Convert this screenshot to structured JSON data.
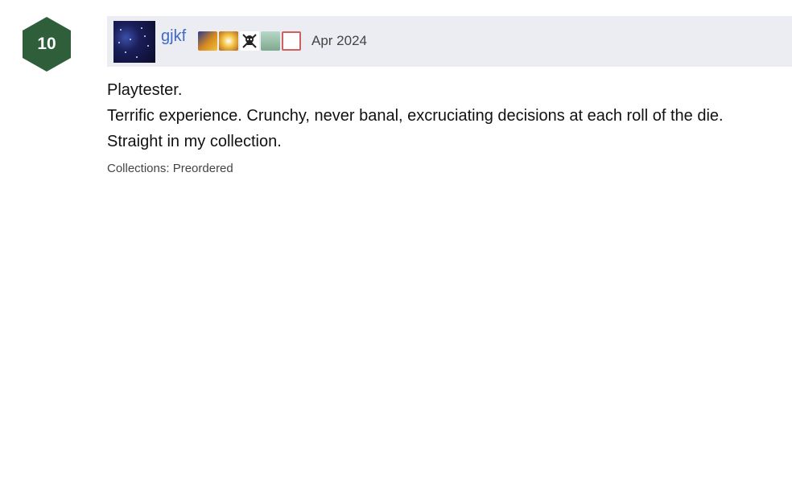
{
  "rating": {
    "value": "10",
    "color": "#2e5e3a"
  },
  "review": {
    "username": "gjkf",
    "date": "Apr 2024",
    "badges": [
      "award-badge",
      "sun-badge",
      "skull-badge",
      "figure-badge",
      "dice-badge"
    ],
    "lines": [
      "Playtester.",
      "Terrific experience. Crunchy, never banal, excruciating decisions at each roll of the die.",
      "Straight in my collection."
    ],
    "collections_label": "Collections: Preordered"
  }
}
